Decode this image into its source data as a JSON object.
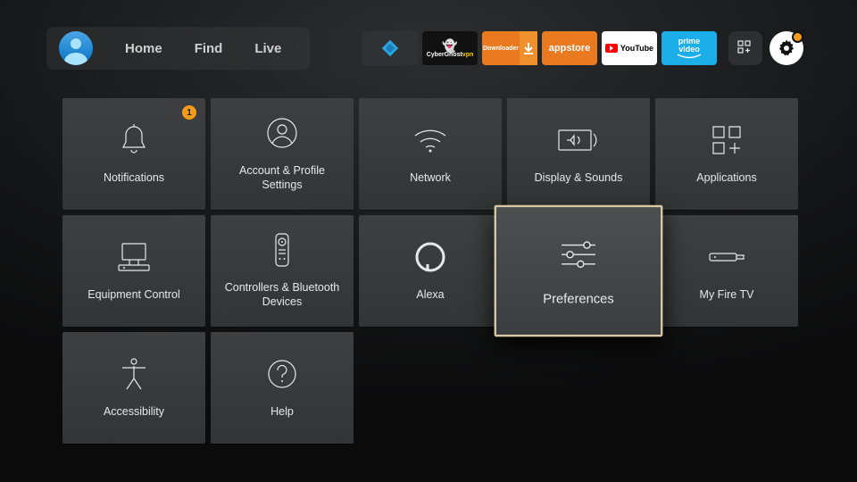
{
  "nav": [
    "Home",
    "Find",
    "Live"
  ],
  "apps": [
    {
      "name": "Kodi"
    },
    {
      "name": "CyberGhost VPN",
      "line1": "CyberGhost",
      "line2": "vpn"
    },
    {
      "name": "Downloader"
    },
    {
      "name": "appstore"
    },
    {
      "name": "YouTube"
    },
    {
      "name": "prime video",
      "line1": "prime",
      "line2": "video"
    }
  ],
  "tiles": [
    {
      "label": "Notifications",
      "badge": "1",
      "icon": "bell"
    },
    {
      "label": "Account & Profile Settings",
      "icon": "user-circle"
    },
    {
      "label": "Network",
      "icon": "wifi"
    },
    {
      "label": "Display & Sounds",
      "icon": "display-sound"
    },
    {
      "label": "Applications",
      "icon": "apps-plus"
    },
    {
      "label": "Equipment Control",
      "icon": "equipment"
    },
    {
      "label": "Controllers & Bluetooth Devices",
      "icon": "remote"
    },
    {
      "label": "Alexa",
      "icon": "alexa-ring"
    },
    {
      "label": "Preferences",
      "icon": "sliders",
      "selected": true
    },
    {
      "label": "My Fire TV",
      "icon": "firetv-stick"
    },
    {
      "label": "Accessibility",
      "icon": "accessibility"
    },
    {
      "label": "Help",
      "icon": "question-circle"
    }
  ],
  "colors": {
    "accent_orange": "#f59b1b",
    "selection_border": "#d7c9a6"
  }
}
